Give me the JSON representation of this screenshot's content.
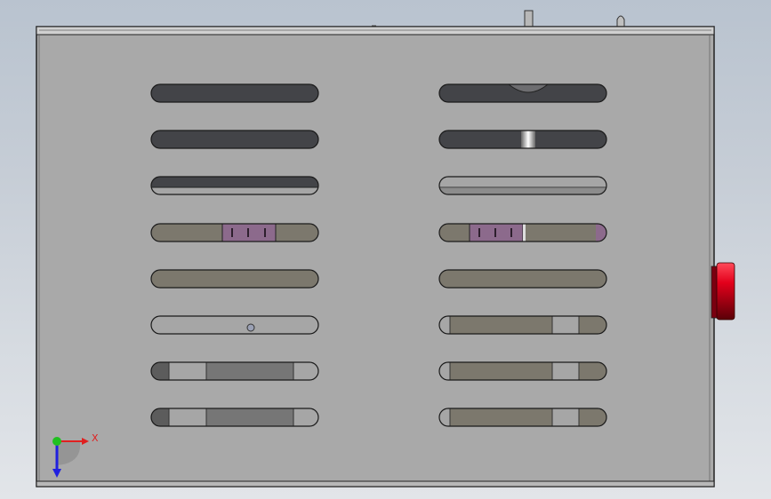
{
  "view": {
    "background_top": "#b9c3cf",
    "background_bottom": "#e2e5e9",
    "panel_color": "#a9a9a9",
    "slot_dark": "#434448",
    "slot_olive": "#7c786d",
    "slot_light": "#a6a6a6",
    "purple_part": "#8c6a8c",
    "knob_red": "#d3001a"
  },
  "triad": {
    "x_label": "X",
    "x_color": "#e02020",
    "y_color": "#20c020",
    "z_color": "#2020e0"
  },
  "slots": {
    "left": [
      {
        "style": "dark"
      },
      {
        "style": "dark"
      },
      {
        "style": "dark-stripe"
      },
      {
        "style": "olive-purple"
      },
      {
        "style": "olive"
      },
      {
        "style": "light-dot"
      },
      {
        "style": "gray-block"
      },
      {
        "style": "gray-block"
      }
    ],
    "right": [
      {
        "style": "dark-notch"
      },
      {
        "style": "dark-highlight"
      },
      {
        "style": "light-stripe"
      },
      {
        "style": "olive-purple-right"
      },
      {
        "style": "olive"
      },
      {
        "style": "olive-block"
      },
      {
        "style": "olive-block"
      },
      {
        "style": "olive-block"
      }
    ]
  }
}
